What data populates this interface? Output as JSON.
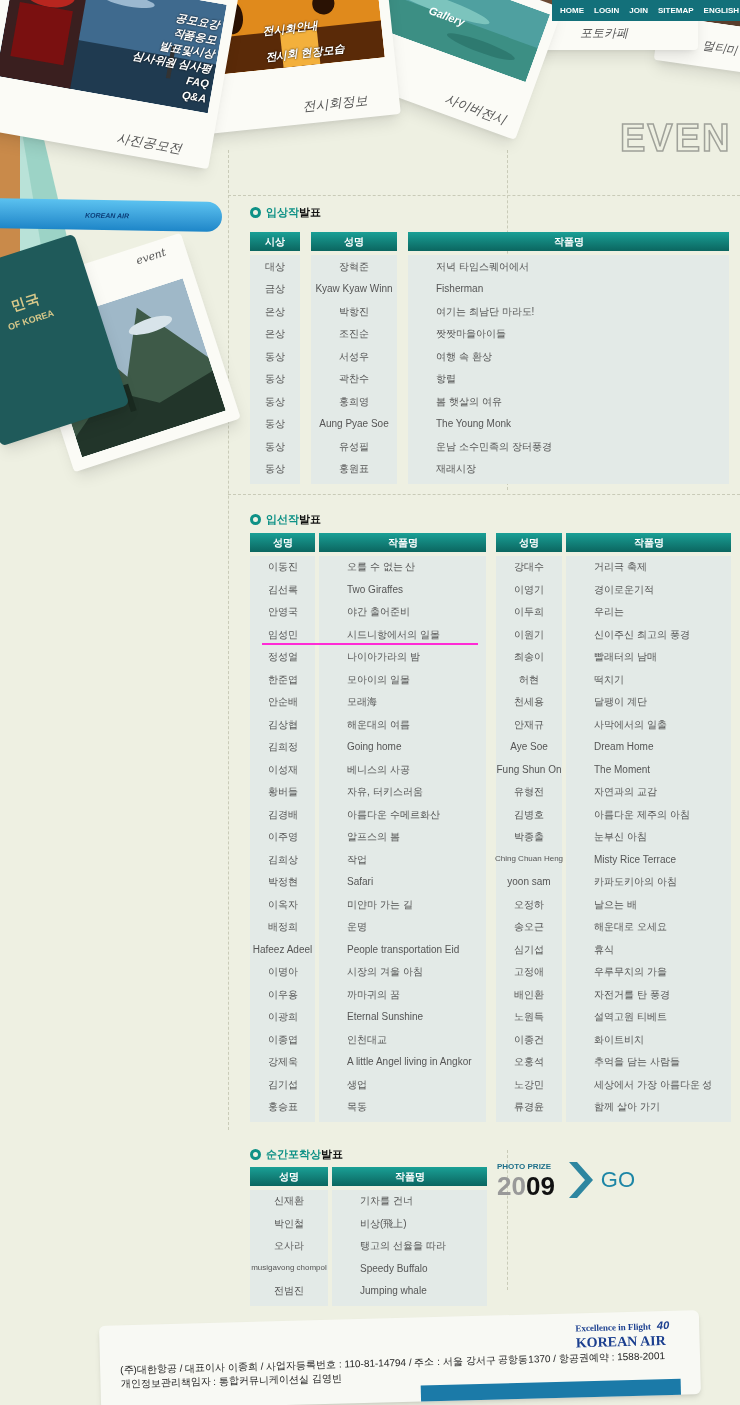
{
  "nav": [
    {
      "label": "HOME"
    },
    {
      "label": "LOGIN"
    },
    {
      "label": "JOIN"
    },
    {
      "label": "SITEMAP"
    },
    {
      "label": "ENGLISH"
    }
  ],
  "polaroids": [
    {
      "caption": "사진공모전",
      "menu": [
        "공모요강",
        "작품응모",
        "발표및시상",
        "심사위원 심사평",
        "FAQ",
        "Q&A"
      ]
    },
    {
      "caption": "전시회정보",
      "menu": [
        "전시회안내",
        "전시회 현장모습"
      ]
    },
    {
      "caption": "사이버전시",
      "menu": [
        "Gallery"
      ]
    },
    {
      "caption": "포토카페"
    },
    {
      "caption": "멀티미"
    },
    {
      "caption": "event"
    }
  ],
  "airplane_label": "KOREAN AIR",
  "passport": {
    "line1": "민국",
    "line2": "OF KOREA"
  },
  "page_title": "EVEN",
  "sections": [
    {
      "title_accent": "입상작",
      "title": "발표",
      "tables": [
        {
          "columns": [
            "시상",
            "성명",
            "작품명"
          ],
          "rows": [
            [
              "대상",
              "장혁준",
              "저녁 타임스퀘어에서"
            ],
            [
              "금상",
              "Kyaw Kyaw Winn",
              "Fisherman"
            ],
            [
              "은상",
              "박항진",
              "여기는 최남단 마라도!"
            ],
            [
              "은상",
              "조진순",
              "짯짯마을아이들"
            ],
            [
              "동상",
              "서성우",
              "여행 속 환상"
            ],
            [
              "동상",
              "곽찬수",
              "항렬"
            ],
            [
              "동상",
              "홍희영",
              "봄 햇살의 여유"
            ],
            [
              "동상",
              "Aung Pyae Soe",
              "The Young Monk"
            ],
            [
              "동상",
              "유성필",
              "운남 소수민족의 장터풍경"
            ],
            [
              "동상",
              "홍원표",
              "재래시장"
            ]
          ]
        }
      ]
    },
    {
      "title_accent": "입선작",
      "title": "발표",
      "tables": [
        {
          "columns": [
            "성명",
            "작품명"
          ],
          "rows": [
            {
              "cells": [
                "이동진",
                "오를 수 없는 산"
              ],
              "underlined": false
            },
            {
              "cells": [
                "김선록",
                "Two Giraffes"
              ],
              "underlined": false
            },
            {
              "cells": [
                "안영국",
                "야간 출어준비"
              ],
              "underlined": false
            },
            {
              "cells": [
                "임성민",
                "시드니항에서의 일몰"
              ],
              "underlined": true
            },
            {
              "cells": [
                "정성얼",
                "나이아가라의 밤"
              ],
              "underlined": false
            },
            {
              "cells": [
                "한준엽",
                "모아이의 일몰"
              ],
              "underlined": false
            },
            {
              "cells": [
                "안순배",
                "모래海"
              ],
              "underlined": false
            },
            {
              "cells": [
                "김상협",
                "해운대의 여름"
              ],
              "underlined": false
            },
            {
              "cells": [
                "김희정",
                "Going home"
              ],
              "underlined": false
            },
            {
              "cells": [
                "이성재",
                "베니스의 사공"
              ],
              "underlined": false
            },
            {
              "cells": [
                "황버들",
                "자유, 터키스러움"
              ],
              "underlined": false
            },
            {
              "cells": [
                "김경배",
                "아름다운 수메르화산"
              ],
              "underlined": false
            },
            {
              "cells": [
                "이주영",
                "알프스의 봄"
              ],
              "underlined": false
            },
            {
              "cells": [
                "김희상",
                "작업"
              ],
              "underlined": false
            },
            {
              "cells": [
                "박정현",
                "Safari"
              ],
              "underlined": false
            },
            {
              "cells": [
                "이옥자",
                "미얀마 가는 길"
              ],
              "underlined": false
            },
            {
              "cells": [
                "배정희",
                "운명"
              ],
              "underlined": false
            },
            {
              "cells": [
                "Hafeez Adeel",
                "People transportation Eid"
              ],
              "underlined": false
            },
            {
              "cells": [
                "이명아",
                "시장의 겨울 아침"
              ],
              "underlined": false
            },
            {
              "cells": [
                "이우용",
                "까마귀의 꿈"
              ],
              "underlined": false
            },
            {
              "cells": [
                "이광희",
                "Eternal Sunshine"
              ],
              "underlined": false
            },
            {
              "cells": [
                "이종엽",
                "인천대교"
              ],
              "underlined": false
            },
            {
              "cells": [
                "강제욱",
                "A little Angel living in Angkor"
              ],
              "underlined": false
            },
            {
              "cells": [
                "김기섭",
                "생업"
              ],
              "underlined": false
            },
            {
              "cells": [
                "홍승표",
                "목동"
              ],
              "underlined": false
            }
          ]
        },
        {
          "columns": [
            "성명",
            "작품명"
          ],
          "rows": [
            [
              "강대수",
              "거리극 축제"
            ],
            [
              "이영기",
              "경이로운기적"
            ],
            [
              "이두희",
              "우리는"
            ],
            [
              "이원기",
              "신이주신 최고의 풍경"
            ],
            [
              "최송이",
              "빨래터의 남매"
            ],
            [
              "허현",
              "떡치기"
            ],
            [
              "천세용",
              "달팽이 계단"
            ],
            [
              "안재규",
              "사막에서의 일출"
            ],
            [
              "Aye Soe",
              "Dream Home"
            ],
            [
              "Fung Shun On",
              "The Moment"
            ],
            [
              "유형전",
              "자연과의 교감"
            ],
            [
              "김병호",
              "아름다운 제주의 아침"
            ],
            [
              "박종출",
              "눈부신 아침"
            ],
            [
              "Ching Chuan Heng",
              "Misty Rice Terrace"
            ],
            [
              "yoon sam",
              "카파도키아의 아침"
            ],
            [
              "오정하",
              "날으는 배"
            ],
            [
              "송오근",
              "해운대로 오세요"
            ],
            [
              "심기섭",
              "휴식"
            ],
            [
              "고정애",
              "우루무치의 가을"
            ],
            [
              "배인환",
              "자전거를 탄 풍경"
            ],
            [
              "노원득",
              "설역고원 티베트"
            ],
            [
              "이종건",
              "화이트비치"
            ],
            [
              "오홍석",
              "추억을 담는 사람들"
            ],
            [
              "노강민",
              "세상에서 가장 아름다운 성"
            ],
            [
              "류경윤",
              "함께 살아 가기"
            ]
          ]
        }
      ]
    },
    {
      "title_accent": "순간포착상",
      "title": "발표",
      "tables": [
        {
          "columns": [
            "성명",
            "작품명"
          ],
          "rows": [
            [
              "신재환",
              "기차를 건너"
            ],
            [
              "박인철",
              "비상(飛上)"
            ],
            [
              "오사라",
              "탱고의 선율을 따라"
            ],
            [
              "musigavong chompol",
              "Speedy Buffalo"
            ],
            [
              "전범진",
              "Jumping whale"
            ]
          ]
        }
      ]
    }
  ],
  "photo_prize": {
    "label": "PHOTO PRIZE",
    "year_light": "20",
    "year_dark": "09",
    "go": "GO"
  },
  "footer": {
    "lines": [
      "(주)대한항공 / 대표이사 이종희 / 사업자등록번호 : 110-81-14794 / 주소 : 서울 강서구 공항동1370 / 항공권예약 : 1588-2001",
      "개인정보관리책임자 : 통합커뮤니케이션실 김영빈"
    ],
    "logo_tagline": "Excellence in Flight",
    "logo_badge": "40",
    "logo_name": "KOREAN AIR"
  }
}
